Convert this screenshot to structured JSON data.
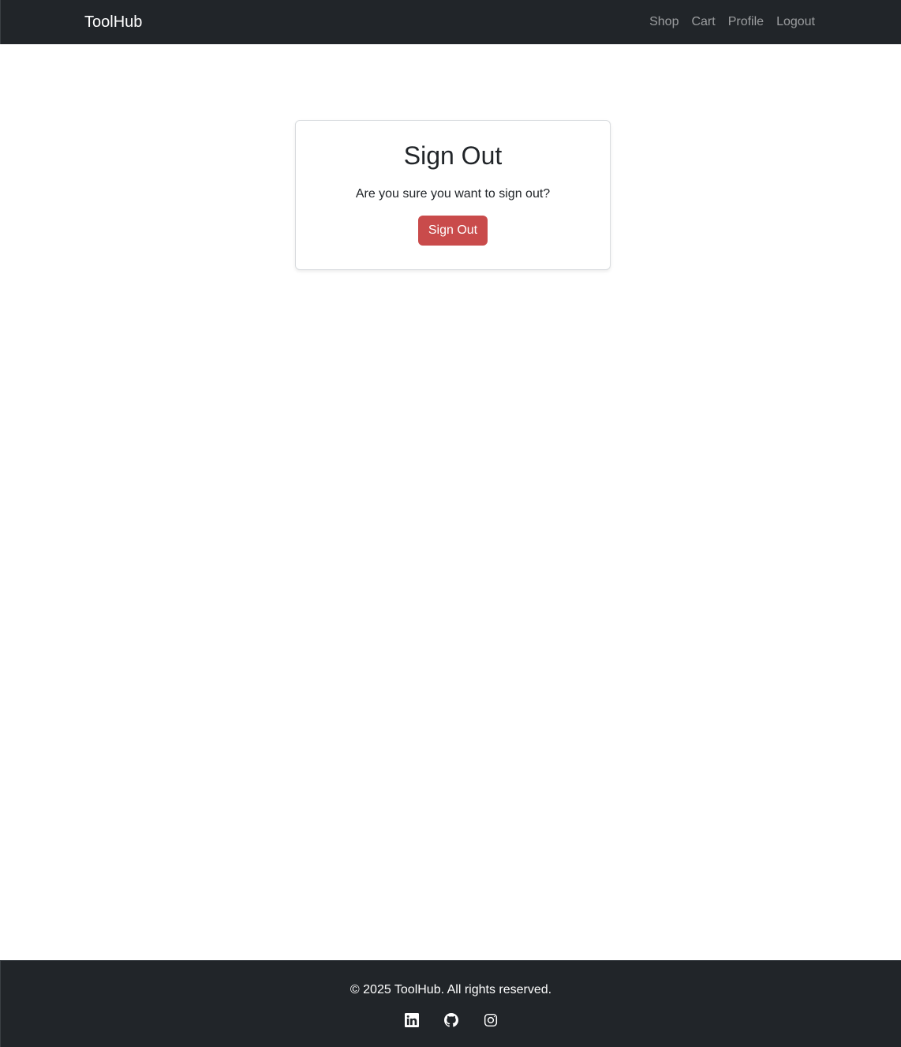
{
  "navbar": {
    "brand": "ToolHub",
    "links": [
      "Shop",
      "Cart",
      "Profile",
      "Logout"
    ]
  },
  "card": {
    "title": "Sign Out",
    "text": "Are you sure you want to sign out?",
    "button_label": "Sign Out"
  },
  "footer": {
    "copyright": "© 2025 ToolHub. All rights reserved.",
    "social_icons": [
      "linkedin-icon",
      "github-icon",
      "instagram-icon"
    ]
  },
  "colors": {
    "navbar_bg": "#212529",
    "danger": "#c94b4b",
    "nav_link": "rgba(255,255,255,0.55)"
  }
}
